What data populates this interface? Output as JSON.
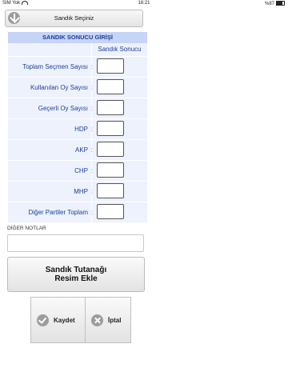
{
  "status_bar": {
    "carrier": "SIM Yok",
    "time": "16:21",
    "battery": "%87"
  },
  "selector": {
    "label": "Sandık Seçiniz"
  },
  "table": {
    "header": "SANDIK SONUCU GİRİŞİ",
    "column": "Sandık Sonucu",
    "colon": ":",
    "rows": [
      {
        "label": "Toplam Seçmen Sayısı",
        "value": ""
      },
      {
        "label": "Kullanılan Oy Sayısı",
        "value": ""
      },
      {
        "label": "Geçerli Oy Sayısı",
        "value": ""
      },
      {
        "label": "HDP",
        "value": ""
      },
      {
        "label": "AKP",
        "value": ""
      },
      {
        "label": "CHP",
        "value": ""
      },
      {
        "label": "MHP",
        "value": ""
      },
      {
        "label": "Diğer Partiler Toplam",
        "value": ""
      }
    ]
  },
  "notes": {
    "label": "DİĞER NOTLAR",
    "value": ""
  },
  "photo_button": {
    "line1": "Sandık Tutanağı",
    "line2": "Resim Ekle"
  },
  "actions": {
    "save": "Kaydet",
    "cancel": "İptal"
  }
}
